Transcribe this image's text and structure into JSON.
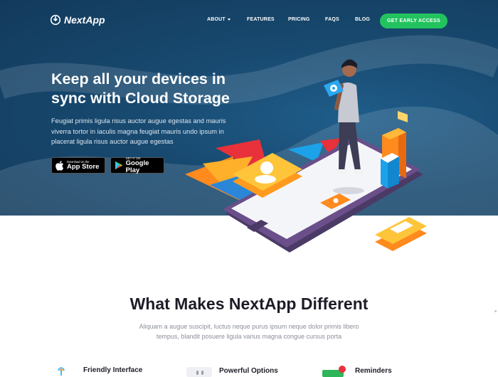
{
  "brand": {
    "name": "NextApp"
  },
  "nav": {
    "items": [
      "ABOUT",
      "FEATURES",
      "PRICING",
      "FAQS",
      "BLOG"
    ],
    "cta": "GET EARLY ACCESS"
  },
  "hero": {
    "title_line1": "Keep all your devices in",
    "title_line2": "sync with Cloud Storage",
    "description": "Feugiat primis ligula risus auctor augue egestas and mauris viverra tortor in iaculis magna feugiat mauris undo ipsum in placerat ligula risus auctor augue egestas",
    "app_store": {
      "small": "Download on the",
      "big": "App Store"
    },
    "google_play": {
      "small": "GET IT ON",
      "big": "Google Play"
    }
  },
  "section": {
    "title": "What Makes NextApp Different",
    "description": "Aliquam a augue suscipit, luctus neque purus ipsum neque dolor primis libero tempus, blandit posuere ligula varius magna congue cursus porta"
  },
  "features": [
    {
      "label": "Friendly Interface",
      "icon": "finger-tap-icon"
    },
    {
      "label": "Powerful Options",
      "icon": "options-icon"
    },
    {
      "label": "Reminders",
      "icon": "reminder-icon"
    }
  ],
  "colors": {
    "hero_bg": "#18496f",
    "cta": "#22c35e",
    "accent_orange": "#ff9a1f"
  }
}
